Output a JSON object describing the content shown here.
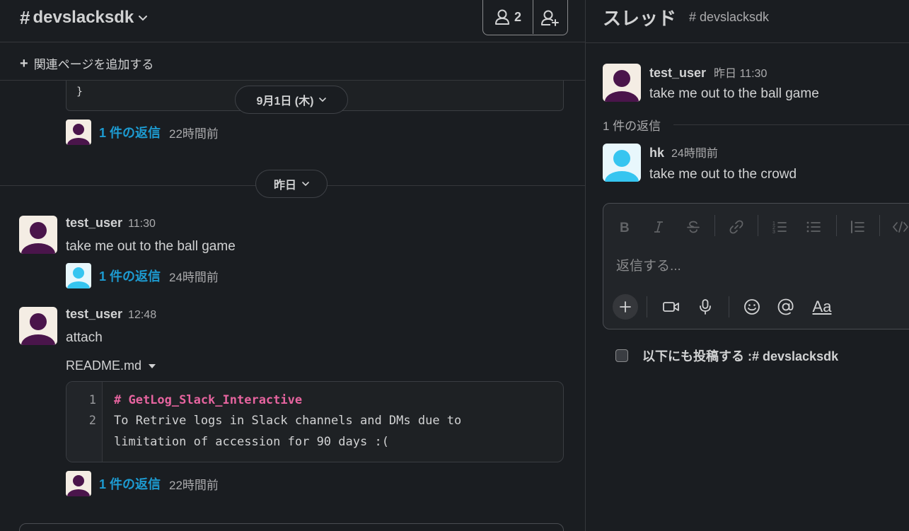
{
  "channel": {
    "hash": "#",
    "name": "devslacksdk",
    "member_count": "2",
    "add_page_label": "関連ページを追加する",
    "code_tail": "}",
    "date_dividers": [
      "9月1日 (木)",
      "昨日"
    ],
    "messages": [
      {
        "thread_replies": "1 件の返信",
        "thread_ago": "22時間前"
      },
      {
        "author": "test_user",
        "time": "11:30",
        "text": "take me out to the ball game",
        "thread_replies": "1 件の返信",
        "thread_ago": "24時間前"
      },
      {
        "author": "test_user",
        "time": "12:48",
        "text": "attach",
        "file_name": "README.md",
        "code_lines": [
          {
            "num": "1",
            "text": "# GetLog_Slack_Interactive"
          },
          {
            "num": "2",
            "text": "To Retrive logs in Slack channels and DMs due to"
          },
          {
            "num": "",
            "text": "limitation of accession for 90 days :("
          }
        ],
        "thread_replies": "1 件の返信",
        "thread_ago": "22時間前"
      }
    ]
  },
  "thread": {
    "title": "スレッド",
    "channel": "# devslacksdk",
    "parent": {
      "author": "test_user",
      "time": "昨日 11:30",
      "text": "take me out to the ball game"
    },
    "reply_count_label": "1 件の返信",
    "replies": [
      {
        "author": "hk",
        "time": "24時間前",
        "text": "take me out to the crowd"
      }
    ],
    "composer": {
      "placeholder": "返信する...",
      "format_icons": [
        "bold-icon",
        "italic-icon",
        "strikethrough-icon",
        "link-icon",
        "ordered-list-icon",
        "bullet-list-icon",
        "blockquote-icon",
        "code-icon"
      ],
      "action_icons": [
        "plus-icon",
        "video-icon",
        "microphone-icon",
        "emoji-icon",
        "mention-icon",
        "formatting-icon"
      ],
      "formatting_label": "Aa"
    },
    "also_send_label": "以下にも投稿する :# devslacksdk"
  },
  "colors": {
    "background": "#1a1d21",
    "link": "#1d9bd1",
    "avatar_purple": "#4a154b",
    "avatar_cyan": "#36c5f0",
    "code_heading": "#e6649f"
  }
}
